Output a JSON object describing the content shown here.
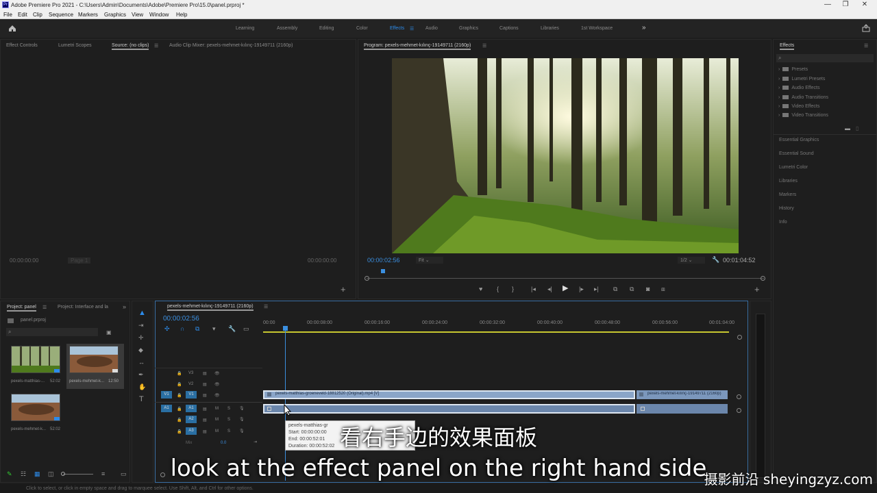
{
  "titlebar": {
    "title": "Adobe Premiere Pro 2021 - C:\\Users\\Admin\\Documents\\Adobe\\Premiere Pro\\15.0\\panel.prproj *",
    "icon": "Pr"
  },
  "menubar": {
    "items": [
      "File",
      "Edit",
      "Clip",
      "Sequence",
      "Markers",
      "Graphics",
      "View",
      "Window",
      "Help"
    ]
  },
  "workspaces": {
    "items": [
      "Learning",
      "Assembly",
      "Editing",
      "Color",
      "Effects",
      "Audio",
      "Graphics",
      "Captions",
      "Libraries",
      "1st Workspace"
    ],
    "active": "Effects",
    "overflow": "»"
  },
  "source_panel": {
    "tabs": [
      "Effect Controls",
      "Lumetri Scopes",
      "Source: (no clips)",
      "Audio Clip Mixer: pexels-mehmet-kılınç-19149711 (2160p)"
    ],
    "tc_left": "00:00:00:00",
    "tc_right": "00:00:00:00",
    "page": "Page 1"
  },
  "program_panel": {
    "title": "Program: pexels-mehmet-kılınç-19149711 (2160p)",
    "tc_current": "00:00:02:56",
    "fit": "Fit",
    "resolution": "1/2",
    "tc_duration": "00:01:04:52"
  },
  "effects_panel": {
    "title": "Effects",
    "items": [
      "Presets",
      "Lumetri Presets",
      "Audio Effects",
      "Audio Transitions",
      "Video Effects",
      "Video Transitions"
    ],
    "side_panels": [
      "Essential Graphics",
      "Essential Sound",
      "Lumetri Color",
      "Libraries",
      "Markers",
      "History",
      "Info"
    ]
  },
  "project_panel": {
    "tabs": [
      "Project: panel",
      "Project: Interface and la"
    ],
    "file": "panel.prproj",
    "clips": [
      {
        "name": "pexels-matthias-...",
        "dur": "52:02"
      },
      {
        "name": "pexels-mehmet-k...",
        "dur": "12:50"
      },
      {
        "name": "pexels-mehmet-k...",
        "dur": "52:02"
      }
    ]
  },
  "timeline": {
    "title": "pexels-mehmet-kılınç-19149711 (2160p)",
    "tc": "00:00:02:56",
    "ruler": [
      "00:00",
      "00:00:08:00",
      "00:00:16:00",
      "00:00:24:00",
      "00:00:32:00",
      "00:00:40:00",
      "00:00:48:00",
      "00:00:56:00",
      "00:01:04:00"
    ],
    "video_tracks": [
      "V3",
      "V2",
      "V1"
    ],
    "audio_tracks": [
      "A1",
      "A2",
      "A3"
    ],
    "source_patch_v": "V1",
    "source_patch_a": "A1",
    "mix_label": "Mix",
    "mix_value": "0.0",
    "clip1": "pexels-matthias-groeneveld-18812520 (Original).mp4 [V]",
    "clip2": "pexels-mehmet-kılınç-19149711 (2160p)"
  },
  "tooltip": {
    "line1": "pexels-matthias-gr",
    "line2": "Start: 00:00:00:00",
    "line3": "End: 00:00:52:01",
    "line4": "Duration: 00:00:52:02"
  },
  "subtitles": {
    "cn": "看右手边的效果面板",
    "en": "look at the effect panel on the right hand side"
  },
  "watermark": "摄影前沿 sheyingzyz.com",
  "status": "Click to select, or click in empty space and drag to marquee select. Use Shift, Alt, and Ctrl for other options.",
  "colors": {
    "accent": "#2d8ceb",
    "clip_video": "#8aa5c8",
    "clip_audio": "#6b86ab",
    "audio_track_patch": "#2a6fa3"
  }
}
